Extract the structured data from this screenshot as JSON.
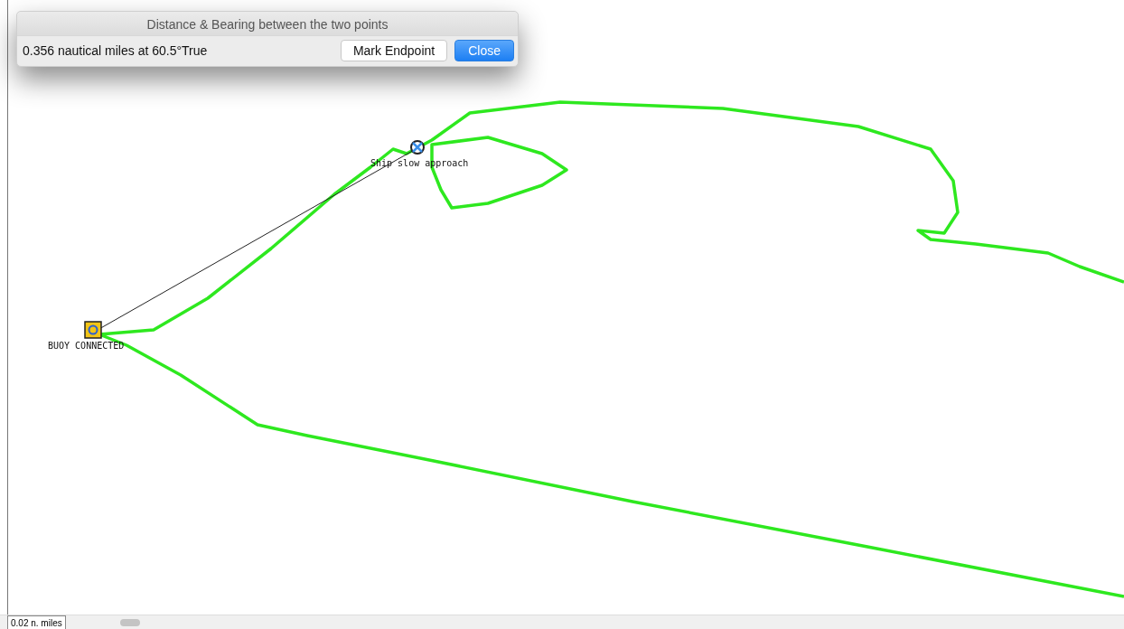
{
  "dialog": {
    "title": "Distance & Bearing between the two points",
    "message": "0.356 nautical miles at 60.5°True",
    "buttons": [
      {
        "label": "Mark Endpoint",
        "kind": "default"
      },
      {
        "label": "Close",
        "kind": "primary"
      }
    ]
  },
  "map": {
    "markers": [
      {
        "label": "Ship slow approach",
        "kind": "ship"
      },
      {
        "label": "BUOY CONNECTED",
        "kind": "buoy"
      }
    ]
  },
  "scale_bar": {
    "label": "0.02 n. miles"
  }
}
